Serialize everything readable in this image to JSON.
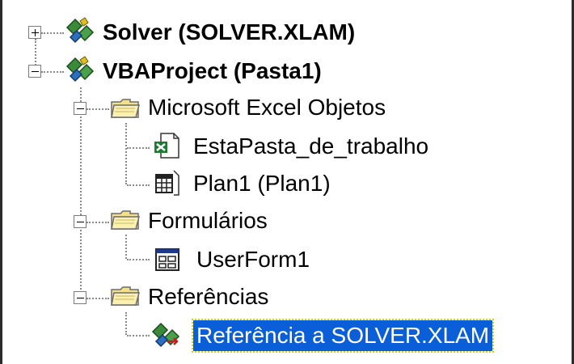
{
  "tree": {
    "nodes": [
      {
        "label": "Solver (SOLVER.XLAM)",
        "bold": true,
        "toggle": "plus",
        "icon": "vba-project-icon"
      },
      {
        "label": "VBAProject (Pasta1)",
        "bold": true,
        "toggle": "minus",
        "icon": "vba-project-icon"
      },
      {
        "label": "Microsoft Excel Objetos",
        "toggle": "minus",
        "icon": "folder-icon"
      },
      {
        "label": "EstaPasta_de_trabalho",
        "icon": "excel-workbook-icon"
      },
      {
        "label": "Plan1 (Plan1)",
        "icon": "worksheet-icon"
      },
      {
        "label": "Formulários",
        "toggle": "minus",
        "icon": "folder-icon"
      },
      {
        "label": "UserForm1",
        "icon": "userform-icon"
      },
      {
        "label": "Referências",
        "toggle": "minus",
        "icon": "folder-icon"
      },
      {
        "label": "Referência a SOLVER.XLAM",
        "selected": true,
        "icon": "reference-icon"
      }
    ],
    "selection_color": "#0a5fd8"
  }
}
